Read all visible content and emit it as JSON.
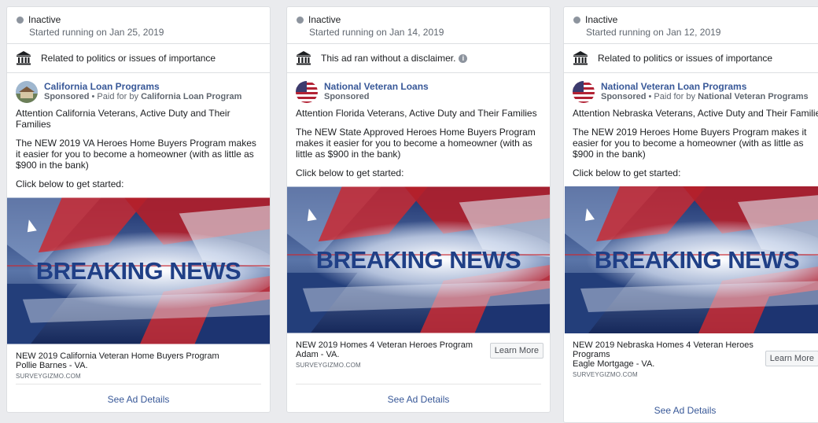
{
  "cards": [
    {
      "status": "Inactive",
      "started": "Started running on Jan 25, 2019",
      "disclaimer": "Related to politics or issues of importance",
      "advertiser": "California Loan Programs",
      "sponsored": "Sponsored",
      "paid_for_prefix": " • Paid for by ",
      "paid_for": "California Loan Program",
      "body": [
        "Attention California Veterans, Active Duty and Their Families",
        "The NEW 2019 VA Heroes Home Buyers Program makes it easier for you to become a homeowner (with as little as $900 in the bank)",
        "Click below to get started:"
      ],
      "image_text": "BREAKING NEWS",
      "footer_title": "NEW 2019 California Veteran Home Buyers Program",
      "footer_sub": "Pollie Barnes - VA.",
      "domain": "SURVEYGIZMO.COM",
      "see_details": "See Ad Details"
    },
    {
      "status": "Inactive",
      "started": "Started running on Jan 14, 2019",
      "disclaimer": "This ad ran without a disclaimer.",
      "advertiser": "National Veteran Loans",
      "sponsored": "Sponsored",
      "body": [
        "Attention Florida Veterans, Active Duty and Their Families",
        "The NEW State Approved Heroes Home Buyers Program makes it easier for you to become a homeowner (with as little as $900 in the bank)",
        "Click below to get started:"
      ],
      "image_text": "BREAKING NEWS",
      "footer_title": "NEW 2019 Homes 4 Veteran Heroes Program",
      "footer_sub": "Adam - VA.",
      "domain": "SURVEYGIZMO.COM",
      "learn_more": "Learn More",
      "see_details": "See Ad Details"
    },
    {
      "status": "Inactive",
      "started": "Started running on Jan 12, 2019",
      "disclaimer": "Related to politics or issues of importance",
      "advertiser": "National Veteran Loan Programs",
      "sponsored": "Sponsored",
      "paid_for_prefix": " • Paid for by ",
      "paid_for": "National Veteran Programs",
      "body": [
        "Attention Nebraska Veterans, Active Duty and Their Families",
        "The NEW 2019 Heroes Home Buyers Program makes it easier for you to become a homeowner (with as little as $900 in the bank)",
        "Click below to get started:"
      ],
      "image_text": "BREAKING NEWS",
      "footer_title": "NEW 2019 Nebraska Homes 4 Veteran Heroes Programs",
      "footer_sub": "Eagle Mortgage - VA.",
      "domain": "SURVEYGIZMO.COM",
      "learn_more": "Learn More",
      "see_details": "See Ad Details"
    }
  ],
  "colors": {
    "link": "#385898",
    "border": "#dddfe2",
    "muted": "#606770"
  }
}
